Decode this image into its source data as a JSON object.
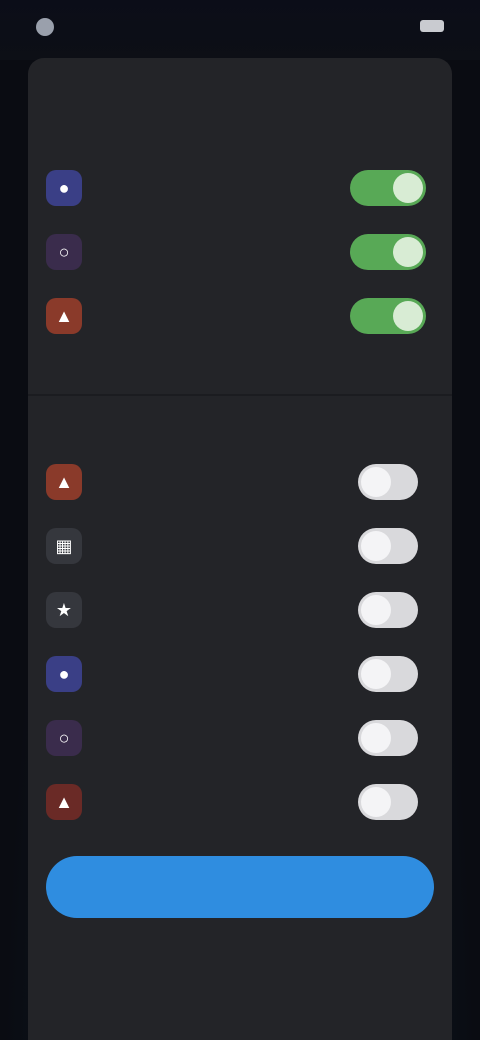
{
  "status_bar": {
    "time": "",
    "signal": "",
    "battery_icon": "battery-icon"
  },
  "sheet": {
    "title": "",
    "enabled_section_label": "",
    "available_section_label": ""
  },
  "enabled_items": [
    {
      "label": "",
      "icon": "person-icon",
      "icon_color": "#3a3f86",
      "on": true
    },
    {
      "label": "",
      "icon": "chat-icon",
      "icon_color": "#3a2c4c",
      "on": true
    },
    {
      "label": "",
      "icon": "flame-icon",
      "icon_color": "#8a3a2a",
      "on": true
    }
  ],
  "available_items": [
    {
      "label": "",
      "icon": "flame-icon",
      "icon_color": "#8a3a2a",
      "on": false
    },
    {
      "label": "",
      "icon": "grid-icon",
      "icon_color": "#35373d",
      "on": false
    },
    {
      "label": "",
      "icon": "star-icon",
      "icon_color": "#35373d",
      "on": false
    },
    {
      "label": "",
      "icon": "person-icon",
      "icon_color": "#3a3f86",
      "on": false
    },
    {
      "label": "",
      "icon": "chat-icon",
      "icon_color": "#3a2c4c",
      "on": false
    },
    {
      "label": "",
      "icon": "flame-icon",
      "icon_color": "#6a2a26",
      "on": false
    }
  ],
  "actions": {
    "primary_label": "",
    "secondary_label": ""
  },
  "colors": {
    "toggle_on": "#58a956",
    "toggle_off": "#d9d9dc",
    "primary_button": "#2f8de0",
    "sheet_background": "#232428"
  }
}
